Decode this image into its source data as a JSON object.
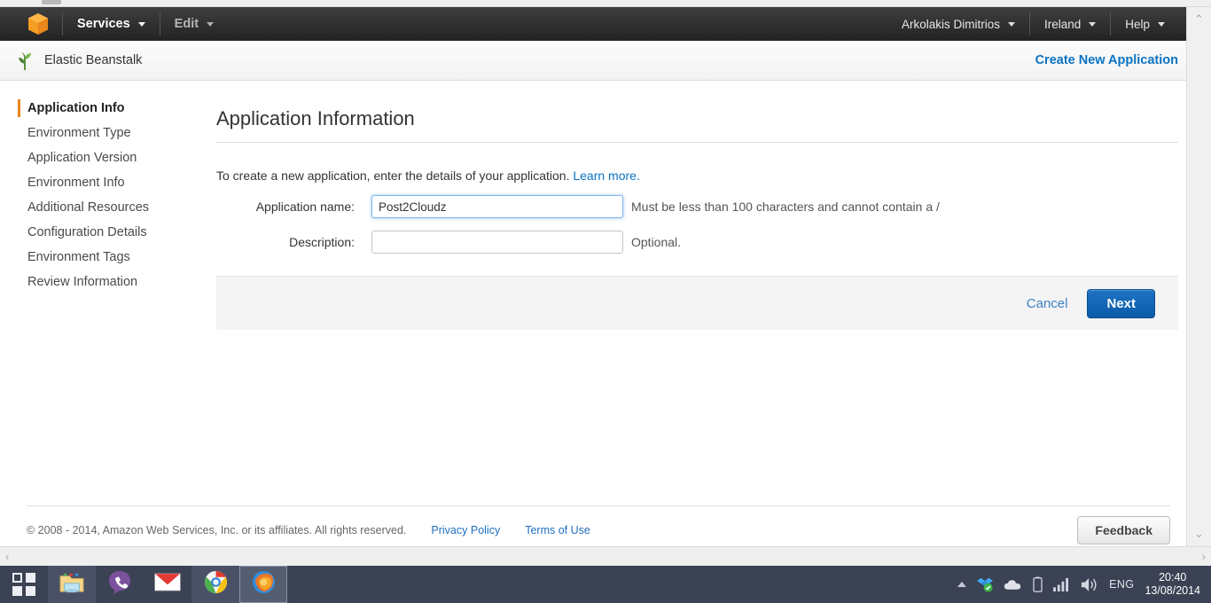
{
  "topnav": {
    "logo_icon": "aws-cube-icon",
    "services_label": "Services",
    "edit_label": "Edit",
    "account_label": "Arkolakis Dimitrios",
    "region_label": "Ireland",
    "help_label": "Help"
  },
  "service_header": {
    "icon": "elastic-beanstalk-icon",
    "title": "Elastic Beanstalk",
    "create_link": "Create New Application"
  },
  "sidebar": {
    "items": [
      {
        "label": "Application Info",
        "active": true
      },
      {
        "label": "Environment Type",
        "active": false
      },
      {
        "label": "Application Version",
        "active": false
      },
      {
        "label": "Environment Info",
        "active": false
      },
      {
        "label": "Additional Resources",
        "active": false
      },
      {
        "label": "Configuration Details",
        "active": false
      },
      {
        "label": "Environment Tags",
        "active": false
      },
      {
        "label": "Review Information",
        "active": false
      }
    ]
  },
  "main": {
    "page_title": "Application Information",
    "intro_text": "To create a new application, enter the details of your application.",
    "intro_link": "Learn more.",
    "fields": {
      "app_name": {
        "label": "Application name:",
        "value": "Post2Cloudz",
        "placeholder": "",
        "hint": "Must be less than 100 characters and cannot contain a /",
        "focused": true
      },
      "description": {
        "label": "Description:",
        "value": "",
        "placeholder": "",
        "hint": "Optional.",
        "focused": false
      }
    },
    "actions": {
      "cancel_label": "Cancel",
      "next_label": "Next"
    }
  },
  "footer": {
    "copyright": "© 2008 - 2014, Amazon Web Services, Inc. or its affiliates. All rights reserved.",
    "privacy_label": "Privacy Policy",
    "terms_label": "Terms of Use",
    "feedback_label": "Feedback"
  },
  "scrollbars": {
    "up_arrow": "⌃",
    "down_arrow": "⌄",
    "left_arrow": "‹",
    "right_arrow": "›"
  },
  "taskbar": {
    "start_icon": "windows-start-icon",
    "apps": [
      {
        "icon": "file-explorer-icon",
        "active": false
      },
      {
        "icon": "viber-icon",
        "active": false
      },
      {
        "icon": "gmail-icon",
        "active": false
      },
      {
        "icon": "chrome-icon",
        "active": false
      },
      {
        "icon": "firefox-icon",
        "active": true
      }
    ],
    "tray": {
      "show_hidden_icon": "up-arrow-icon",
      "dropbox_icon": "dropbox-icon",
      "onedrive_icon": "onedrive-cloud-icon",
      "battery_icon": "battery-icon",
      "signal_icon": "signal-bars-icon",
      "volume_icon": "volume-icon",
      "language": "ENG",
      "time": "20:40",
      "date": "13/08/2014"
    }
  },
  "colors": {
    "aws_orange": "#e8871a",
    "link_blue": "#0a73c4",
    "button_blue": "#0a5ba8",
    "taskbar_bg": "#3b4254"
  }
}
